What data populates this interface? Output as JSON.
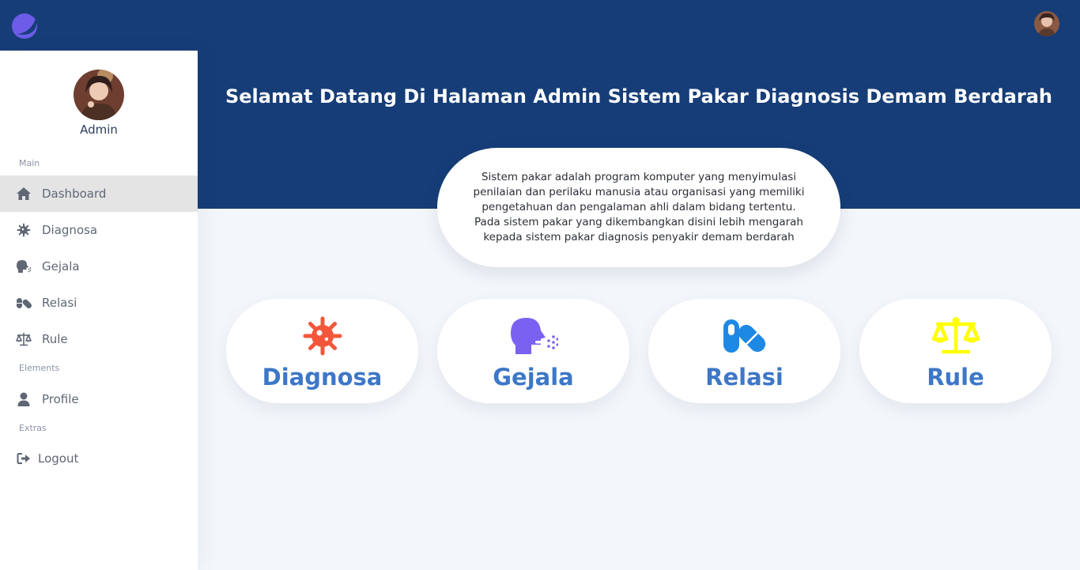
{
  "brand": {
    "logo_icon": "crescent-logo-icon",
    "accent": "#6c5ce7"
  },
  "topbar": {
    "avatar_icon": "user-avatar-photo"
  },
  "sidebar": {
    "profile": {
      "name": "Admin"
    },
    "sections": {
      "main": "Main",
      "elements": "Elements",
      "extras": "Extras"
    },
    "items": [
      {
        "label": "Dashboard",
        "icon": "home-icon",
        "active": true
      },
      {
        "label": "Diagnosa",
        "icon": "virus-icon"
      },
      {
        "label": "Gejala",
        "icon": "head-side-cough-icon"
      },
      {
        "label": "Relasi",
        "icon": "pills-icon"
      },
      {
        "label": "Rule",
        "icon": "balance-scale-icon"
      },
      {
        "label": "Profile",
        "icon": "user-icon"
      },
      {
        "label": "Logout",
        "icon": "sign-out-icon"
      }
    ]
  },
  "hero": {
    "title": "Selamat Datang Di Halaman Admin Sistem Pakar Diagnosis Demam Berdarah",
    "info_lines": [
      "Sistem pakar adalah program komputer yang menyimulasi",
      "penilaian dan perilaku manusia atau organisasi yang memiliki",
      "pengetahuan dan pengalaman ahli dalam bidang tertentu.",
      "Pada sistem pakar yang dikembangkan disini lebih mengarah",
      "kepada sistem pakar diagnosis penyakir demam berdarah"
    ]
  },
  "tiles": [
    {
      "label": "Diagnosa",
      "icon": "virus-icon",
      "color": "#f4563a"
    },
    {
      "label": "Gejala",
      "icon": "head-side-cough-icon",
      "color": "#7b61f0"
    },
    {
      "label": "Relasi",
      "icon": "pills-icon",
      "color": "#1e88e5"
    },
    {
      "label": "Rule",
      "icon": "balance-scale-icon",
      "color": "#ffff00"
    }
  ],
  "colors": {
    "header_bg": "#163d77",
    "tile_text": "#3d77c7",
    "page_bg": "#f3f6fa"
  }
}
